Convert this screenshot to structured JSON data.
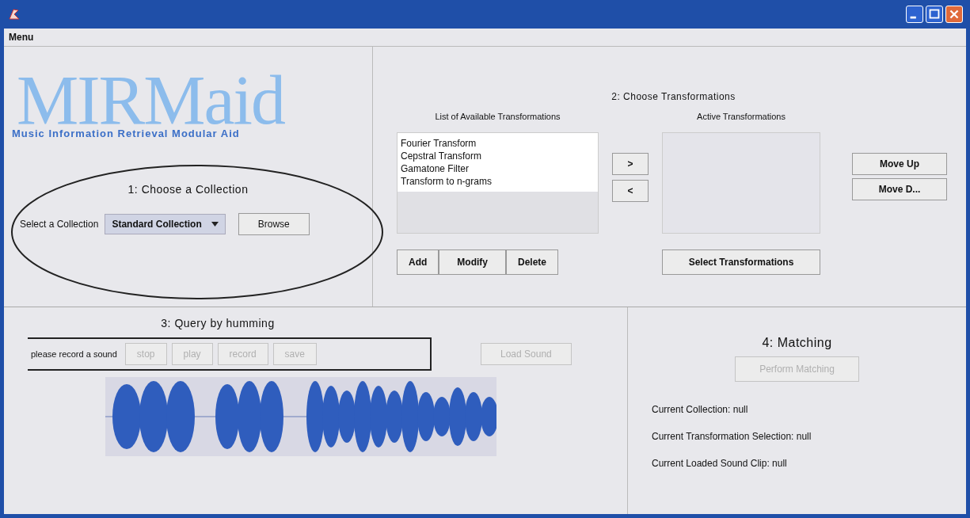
{
  "window": {
    "menu": [
      "Menu"
    ]
  },
  "collection": {
    "logo_title": "MIRMaid",
    "logo_subtitle": "Music Information Retrieval Modular Aid",
    "heading": "1: Choose a Collection",
    "select_label": "Select a Collection",
    "dropdown_value": "Standard Collection",
    "browse_button": "Browse"
  },
  "transformations": {
    "heading": "2: Choose Transformations",
    "available_label": "List of Available Transformations",
    "available": [
      {
        "label": "Fourier Transform"
      },
      {
        "label": "Cepstral Transform"
      },
      {
        "label": "Gamatone Filter"
      },
      {
        "label": "Transform to n-grams"
      }
    ],
    "list_buttons": [
      "Add",
      "Modify",
      "Delete"
    ],
    "arrow_buttons": [
      ">",
      "<"
    ],
    "active_label": "Active Transformations",
    "select_button": "Select Transformations",
    "move_buttons": [
      "Move Up",
      "Move D..."
    ]
  },
  "humming": {
    "heading": "3: Query by humming",
    "record_label": "please record a sound",
    "buttons": [
      {
        "label": "stop",
        "disabled": true
      },
      {
        "label": "play",
        "disabled": true
      },
      {
        "label": "record",
        "disabled": true
      },
      {
        "label": "save",
        "disabled": true
      }
    ],
    "load_button": {
      "label": "Load Sound",
      "disabled": true
    }
  },
  "matching": {
    "heading": "4: Matching",
    "button": {
      "label": "Perform Matching",
      "disabled": true
    },
    "status": [
      "Current Collection: null",
      "Current Transformation Selection: null",
      "Current Loaded Sound Clip: null"
    ]
  }
}
